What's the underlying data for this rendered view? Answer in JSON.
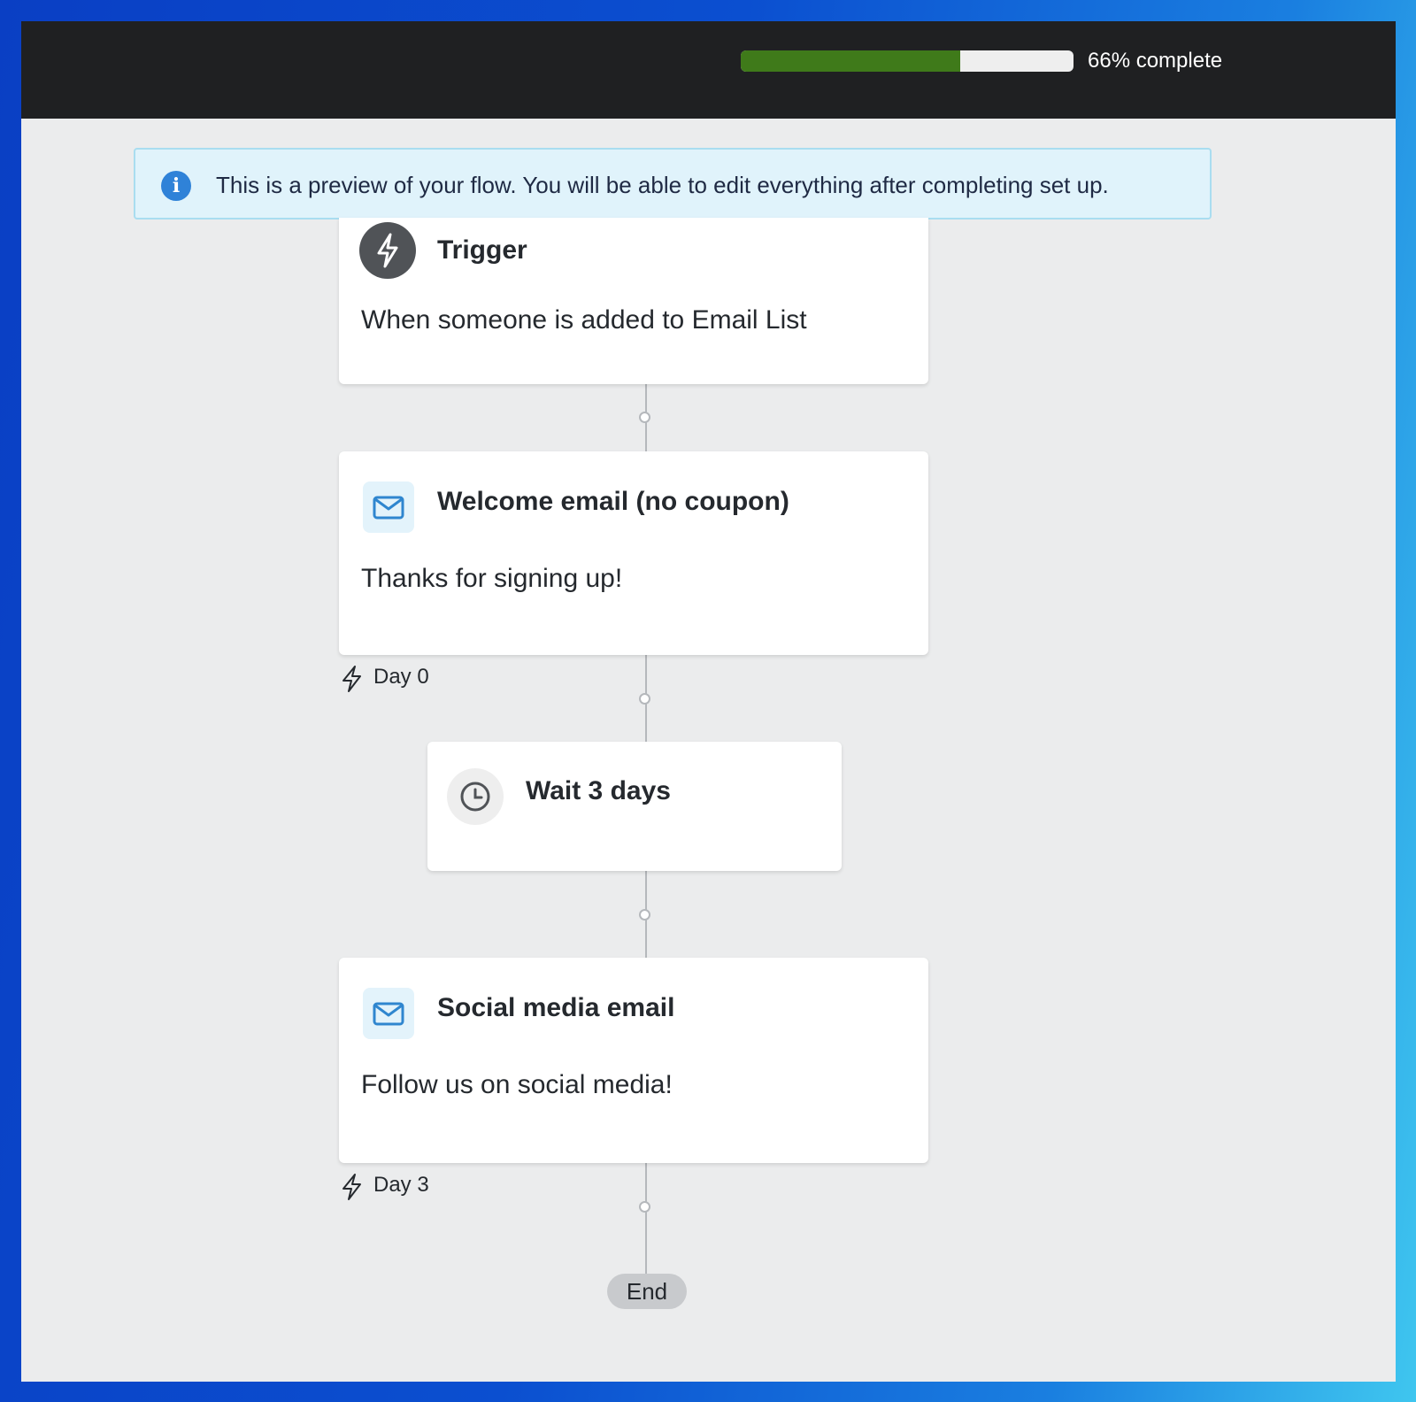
{
  "header": {
    "progress": {
      "percent": 66,
      "label": "66% complete",
      "fill_color": "#3f7a1a"
    }
  },
  "banner": {
    "icon": "info-icon",
    "message": "This is a preview of your flow. You will be able to edit everything after completing set up."
  },
  "flow": {
    "trigger": {
      "icon": "lightning-icon",
      "title": "Trigger",
      "description": "When someone is added to Email List"
    },
    "welcome_email": {
      "icon": "mail-icon",
      "title": "Welcome email (no coupon)",
      "description": "Thanks for signing up!",
      "day_label": "Day 0"
    },
    "wait": {
      "icon": "clock-icon",
      "title": "Wait 3 days"
    },
    "social_email": {
      "icon": "mail-icon",
      "title": "Social media email",
      "description": "Follow us on social media!",
      "day_label": "Day 3"
    },
    "end_label": "End"
  }
}
